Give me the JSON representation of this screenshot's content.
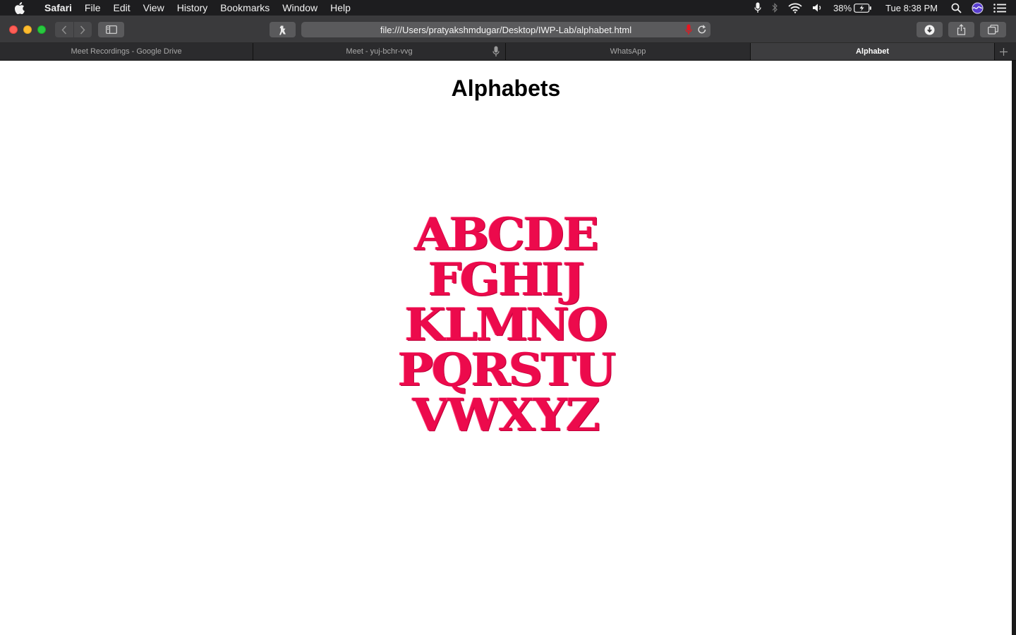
{
  "menubar": {
    "app_name": "Safari",
    "menus": [
      "File",
      "Edit",
      "View",
      "History",
      "Bookmarks",
      "Window",
      "Help"
    ],
    "battery": "38%",
    "clock": "Tue 8:38 PM"
  },
  "toolbar": {
    "url": "file:///Users/pratyakshmdugar/Desktop/IWP-Lab/alphabet.html"
  },
  "tabs": [
    {
      "title": "Meet Recordings - Google Drive",
      "active": false
    },
    {
      "title": "Meet - yuj-bchr-vvg",
      "active": false
    },
    {
      "title": "WhatsApp",
      "active": false
    },
    {
      "title": "Alphabet",
      "active": true
    }
  ],
  "page": {
    "heading": "Alphabets",
    "image_rows": [
      [
        "A",
        "B",
        "C",
        "D",
        "E"
      ],
      [
        "F",
        "G",
        "H",
        "I",
        "J"
      ],
      [
        "K",
        "L",
        "M",
        "N",
        "O"
      ],
      [
        "P",
        "Q",
        "R",
        "S",
        "T",
        "U"
      ],
      [
        "V",
        "W",
        "X",
        "Y",
        "Z"
      ]
    ],
    "image_color": "#ec0a4c"
  }
}
